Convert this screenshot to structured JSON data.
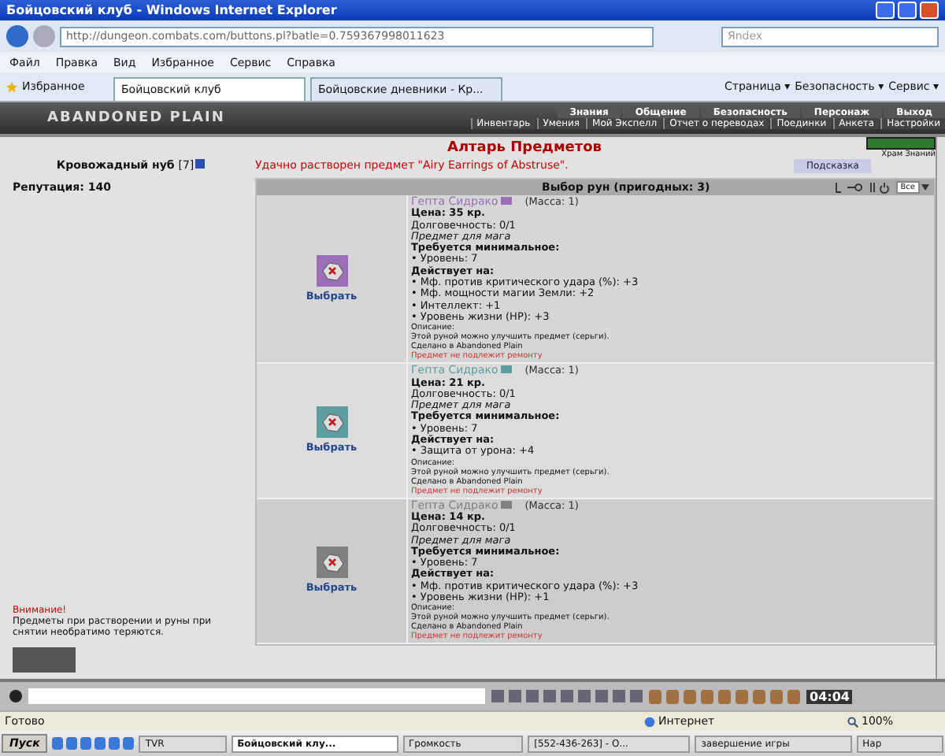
{
  "window": {
    "title": "Бойцовский клуб - Windows Internet Explorer"
  },
  "address": {
    "url": "http://dungeon.combats.com/buttons.pl?batle=0.759367998011623",
    "search_placeholder": "Яndex"
  },
  "menu": [
    "Файл",
    "Правка",
    "Вид",
    "Избранное",
    "Сервис",
    "Справка"
  ],
  "favorites": "Избранное",
  "tabs": [
    {
      "label": "Бойцовский клуб",
      "selected": true
    },
    {
      "label": "Бойцовские дневники - Кр...",
      "selected": false
    }
  ],
  "toolbar": [
    "Страница ▾",
    "Безопасность ▾",
    "Сервис ▾"
  ],
  "game": {
    "logo": "ABANDONED PLAIN",
    "nav_top": [
      "Знания",
      "Общение",
      "Безопасность",
      "Персонаж",
      "Выход"
    ],
    "nav_bottom": [
      "Инвентарь",
      "Умения",
      "Мой Экспелл",
      "Отчет о переводах",
      "Поединки",
      "Анкета",
      "Настройки"
    ],
    "player": {
      "name": "Кровожадный нуб",
      "level": "[7]",
      "reputation": "Репутация: 140"
    },
    "title": "Алтарь Предметов",
    "message": "Удачно растворен предмет \"Airy Earrings of Abstruse\".",
    "hint_button": "Подсказка",
    "location": "Храм Знаний",
    "table": {
      "header": "Выбор рун (пригодных: 3)",
      "filter": "Все",
      "rows": [
        {
          "name": "Гепта Сидрако",
          "color": "#9a6fb8",
          "mass": "(Масса: 1)",
          "price": "Цена: 35 кр.",
          "durability": "Долговечность: 0/1",
          "for": "Предмет для мага",
          "req_title": "Требуется минимальное:",
          "req": [
            "• Уровень: 7"
          ],
          "acts_title": "Действует на:",
          "acts": [
            "• Мф. против критического удара (%): +3",
            "• Мф. мощности магии Земли: +2",
            "• Интеллект: +1",
            "• Уровень жизни (HP): +3"
          ],
          "desc_title": "Описание:",
          "desc": "Этой руной можно улучшить предмет (серьги).",
          "made": "Сделано в Abandoned Plain",
          "repair": "Предмет не подлежит ремонту",
          "select": "Выбрать"
        },
        {
          "name": "Гепта Сидрако",
          "color": "#5f9ea0",
          "mass": "(Масса: 1)",
          "price": "Цена: 21 кр.",
          "durability": "Долговечность: 0/1",
          "for": "Предмет для мага",
          "req_title": "Требуется минимальное:",
          "req": [
            "• Уровень: 7"
          ],
          "acts_title": "Действует на:",
          "acts": [
            "• Защита от урона: +4"
          ],
          "desc_title": "Описание:",
          "desc": "Этой руной можно улучшить предмет (серьги).",
          "made": "Сделано в Abandoned Plain",
          "repair": "Предмет не подлежит ремонту",
          "select": "Выбрать"
        },
        {
          "name": "Гепта Сидрако",
          "color": "#808080",
          "mass": "(Масса: 1)",
          "price": "Цена: 14 кр.",
          "durability": "Долговечность: 0/1",
          "for": "Предмет для мага",
          "req_title": "Требуется минимальное:",
          "req": [
            "• Уровень: 7"
          ],
          "acts_title": "Действует на:",
          "acts": [
            "• Мф. против критического удара (%): +3",
            "• Уровень жизни (HP): +1"
          ],
          "desc_title": "Описание:",
          "desc": "Этой руной можно улучшить предмет (серьги).",
          "made": "Сделано в Abandoned Plain",
          "repair": "Предмет не подлежит ремонту",
          "select": "Выбрать"
        }
      ]
    },
    "warning_title": "Внимание!",
    "warning": "Предметы при растворении и руны при снятии необратимо теряются.",
    "clock": "04:04"
  },
  "status_bar": {
    "status": "Готово",
    "zone": "Интернет",
    "zoom": "100%"
  },
  "taskbar": {
    "start": "Пуск",
    "items": [
      {
        "label": "TVR",
        "selected": false
      },
      {
        "label": "Бойцовский клу...",
        "selected": true
      },
      {
        "label": "Громкость",
        "selected": false
      },
      {
        "label": "[552-436-263] - О...",
        "selected": false
      },
      {
        "label": "завершение игры",
        "selected": false
      },
      {
        "label": "Нар",
        "selected": false
      }
    ]
  }
}
